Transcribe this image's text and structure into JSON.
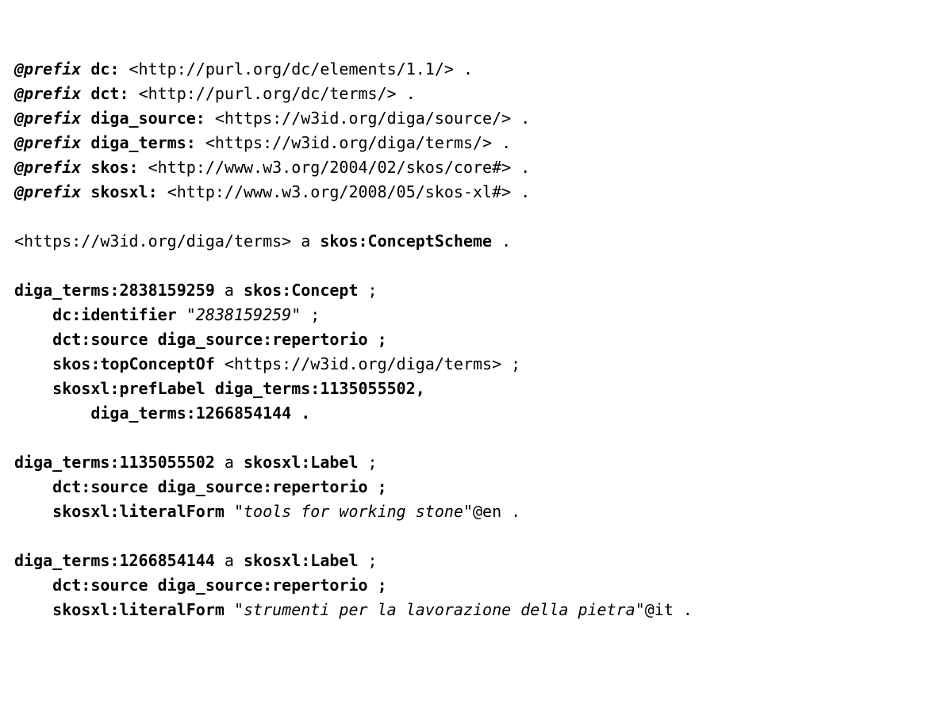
{
  "prefixes": [
    {
      "kw": "@prefix",
      "name": "dc:",
      "uri": "<http://purl.org/dc/elements/1.1/> ."
    },
    {
      "kw": "@prefix",
      "name": "dct:",
      "uri": "<http://purl.org/dc/terms/> ."
    },
    {
      "kw": "@prefix",
      "name": "diga_source:",
      "uri": "<https://w3id.org/diga/source/> ."
    },
    {
      "kw": "@prefix",
      "name": "diga_terms:",
      "uri": "<https://w3id.org/diga/terms/> ."
    },
    {
      "kw": "@prefix",
      "name": "skos:",
      "uri": "<http://www.w3.org/2004/02/skos/core#> ."
    },
    {
      "kw": "@prefix",
      "name": "skosxl:",
      "uri": "<http://www.w3.org/2008/05/skos-xl#> ."
    }
  ],
  "scheme": {
    "subject": "<https://w3id.org/diga/terms>",
    "a": " a ",
    "type": "skos:ConceptScheme",
    "end": " ."
  },
  "concept": {
    "subj": "diga_terms:2838159259",
    "a": " a ",
    "type": "skos:Concept",
    "semi": " ;",
    "l1_pred": "dc:identifier",
    "l1_sp": " ",
    "l1_val": "\"2838159259\"",
    "l1_end": " ;",
    "l2": "dct:source diga_source:repertorio ;",
    "l3_pred": "skos:topConceptOf",
    "l3_sp": " ",
    "l3_val": "<https://w3id.org/diga/terms>",
    "l3_end": " ;",
    "l4": "skosxl:prefLabel diga_terms:1135055502,",
    "l5": "diga_terms:1266854144 ."
  },
  "label1": {
    "subj": "diga_terms:1135055502",
    "a": " a ",
    "type": "skosxl:Label",
    "semi": " ;",
    "l1": "dct:source diga_source:repertorio ;",
    "l2_pred": "skosxl:literalForm",
    "l2_sp": " \"",
    "l2_val": "tools for working stone",
    "l2_end": "\"@en ."
  },
  "label2": {
    "subj": "diga_terms:1266854144",
    "a": " a ",
    "type": "skosxl:Label",
    "semi": " ;",
    "l1": "dct:source diga_source:repertorio ;",
    "l2_pred": "skosxl:literalForm",
    "l2_sp": " \"",
    "l2_val": "strumenti per la lavorazione della pietra",
    "l2_end": "\"@it ."
  }
}
